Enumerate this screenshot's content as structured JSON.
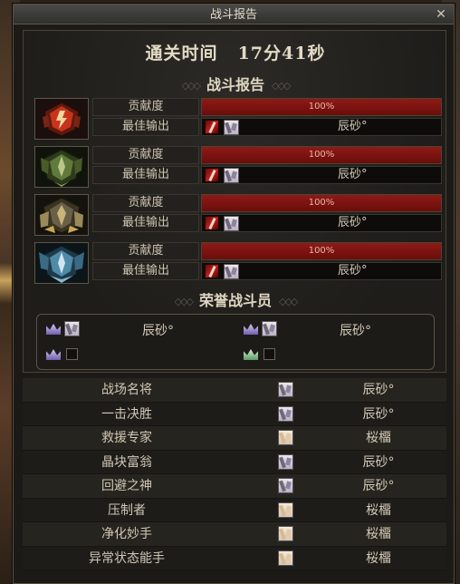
{
  "window": {
    "title": "战斗报告",
    "close_symbol": "✕"
  },
  "clear_time": {
    "label": "通关时间",
    "value": "17分41秒"
  },
  "report_header": "战斗报告",
  "players": [
    {
      "theme": "fire",
      "contribution_label": "贡献度",
      "contribution_pct": "100%",
      "contribution_fill": 1.0,
      "best_output_label": "最佳输出",
      "best_output_name": "辰砂°"
    },
    {
      "theme": "nature",
      "contribution_label": "贡献度",
      "contribution_pct": "100%",
      "contribution_fill": 1.0,
      "best_output_label": "最佳输出",
      "best_output_name": "辰砂°"
    },
    {
      "theme": "stone",
      "contribution_label": "贡献度",
      "contribution_pct": "100%",
      "contribution_fill": 1.0,
      "best_output_label": "最佳输出",
      "best_output_name": "辰砂°"
    },
    {
      "theme": "ice",
      "contribution_label": "贡献度",
      "contribution_pct": "100%",
      "contribution_fill": 1.0,
      "best_output_label": "最佳输出",
      "best_output_name": "辰砂°"
    }
  ],
  "honor_header": "荣誉战斗员",
  "honor": [
    {
      "name": "辰砂°",
      "crown": "purple"
    },
    {
      "name": "辰砂°",
      "crown": "purple"
    },
    {
      "name": "",
      "crown": "purple"
    },
    {
      "name": "",
      "crown": "green"
    }
  ],
  "titles": [
    {
      "title": "战场名将",
      "player": "辰砂°",
      "portrait": "grey"
    },
    {
      "title": "一击决胜",
      "player": "辰砂°",
      "portrait": "grey"
    },
    {
      "title": "救援专家",
      "player": "桜橊",
      "portrait": "blonde"
    },
    {
      "title": "晶块富翁",
      "player": "辰砂°",
      "portrait": "grey"
    },
    {
      "title": "回避之神",
      "player": "辰砂°",
      "portrait": "grey"
    },
    {
      "title": "压制者",
      "player": "桜橊",
      "portrait": "blonde"
    },
    {
      "title": "净化妙手",
      "player": "桜橊",
      "portrait": "blonde"
    },
    {
      "title": "异常状态能手",
      "player": "桜橊",
      "portrait": "blonde"
    }
  ],
  "colors": {
    "bar_red": "#8e1a16",
    "fire": "#c8331c",
    "nature": "#5f7a3a",
    "stone": "#9a8a5a",
    "ice": "#4f8aa8"
  }
}
